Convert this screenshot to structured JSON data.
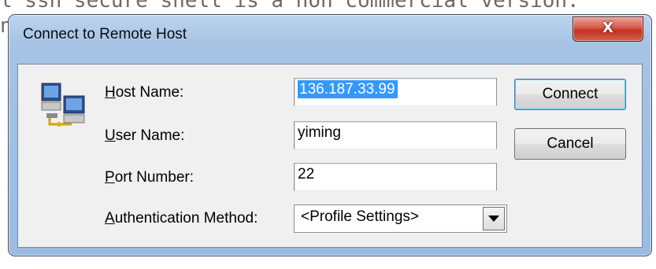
{
  "background": {
    "line1": "l ssh secure shell is a non commercial version.",
    "line2": "n"
  },
  "window": {
    "title": "Connect to Remote Host",
    "close_glyph": "X"
  },
  "form": {
    "host_label_u": "H",
    "host_label_rest": "ost Name:",
    "user_label_u": "U",
    "user_label_rest": "ser Name:",
    "port_label_u": "P",
    "port_label_rest": "ort Number:",
    "auth_label_u": "A",
    "auth_label_rest": "uthentication Method:",
    "host_value": "136.187.33.99",
    "user_value": "yiming",
    "port_value": "22",
    "auth_selected": "<Profile Settings>"
  },
  "buttons": {
    "connect": "Connect",
    "cancel": "Cancel"
  },
  "icons": {
    "dialog_icon": "networked-computers-icon",
    "dropdown_icon": "chevron-down-icon",
    "close_icon": "close-icon"
  }
}
